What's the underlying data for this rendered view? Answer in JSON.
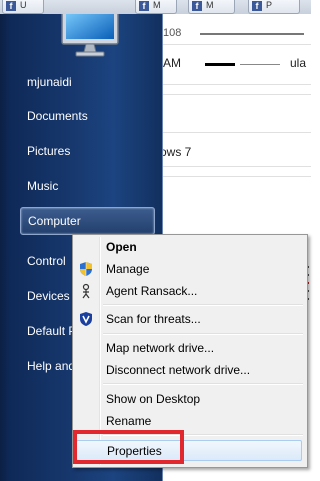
{
  "browser": {
    "tabs": [
      {
        "label": "U"
      },
      {
        "label": "M"
      },
      {
        "label": "M"
      },
      {
        "label": "P"
      }
    ],
    "fragments": {
      "top_right": "108",
      "row2_left": "AM",
      "row2_right": "ula",
      "row3": "ows 7"
    }
  },
  "start_menu": {
    "items": [
      {
        "label": "mjunaidi"
      },
      {
        "label": "Documents"
      },
      {
        "label": "Pictures"
      },
      {
        "label": "Music"
      },
      {
        "label": "Computer"
      },
      {
        "label": "Control"
      },
      {
        "label": "Devices"
      },
      {
        "label": "Default P"
      },
      {
        "label": "Help and"
      }
    ]
  },
  "context_menu": {
    "items": [
      {
        "label": "Open",
        "bold": true
      },
      {
        "label": "Manage",
        "icon": "uac-shield-icon"
      },
      {
        "label": "Agent Ransack...",
        "icon": "agent-ransack-icon"
      },
      {
        "label": "Scan for threats...",
        "icon": "antivirus-shield-icon"
      },
      {
        "label": "Map network drive..."
      },
      {
        "label": "Disconnect network drive..."
      },
      {
        "label": "Show on Desktop"
      },
      {
        "label": "Rename"
      },
      {
        "label": "Properties",
        "highlighted": true
      }
    ]
  },
  "colors": {
    "start_menu_bg": "#17386e",
    "highlight_box": "#e0282e",
    "facebook": "#3b5998"
  }
}
